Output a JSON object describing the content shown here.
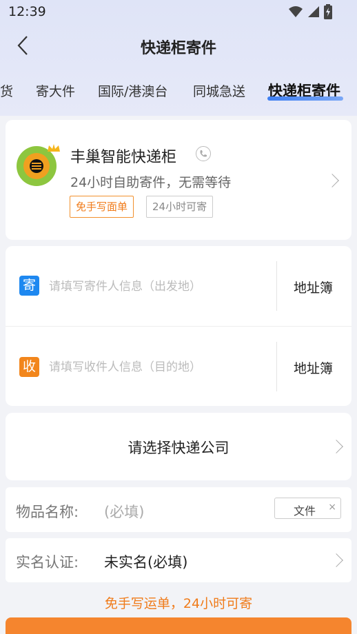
{
  "status_bar": {
    "time": "12:39"
  },
  "header": {
    "title": "快递柜寄件"
  },
  "tabs": [
    {
      "label": "货"
    },
    {
      "label": "寄大件"
    },
    {
      "label": "国际/港澳台"
    },
    {
      "label": "同城急送"
    },
    {
      "label": "快递柜寄件",
      "active": true
    }
  ],
  "store": {
    "name": "丰巢智能快递柜",
    "description": "24小时自助寄件，无需等待",
    "badges": [
      "免手写面单",
      "24小时可寄"
    ]
  },
  "sender": {
    "tag": "寄",
    "placeholder": "请填写寄件人信息（出发地）",
    "book_label": "地址簿"
  },
  "receiver": {
    "tag": "收",
    "placeholder": "请填写收件人信息（目的地）",
    "book_label": "地址簿"
  },
  "courier": {
    "label": "请选择快递公司"
  },
  "item": {
    "label": "物品名称:",
    "placeholder": "(必填)",
    "tag": "文件",
    "tag_close": "×"
  },
  "real_name": {
    "label": "实名认证:",
    "value": "未实名(必填)"
  },
  "hint": "免手写运单，24小时可寄",
  "colors": {
    "accent": "#f5852e",
    "sender_tag": "#1e88f0",
    "receiver_tag": "#f2861c",
    "tab_underline": "#3f7ff2"
  }
}
